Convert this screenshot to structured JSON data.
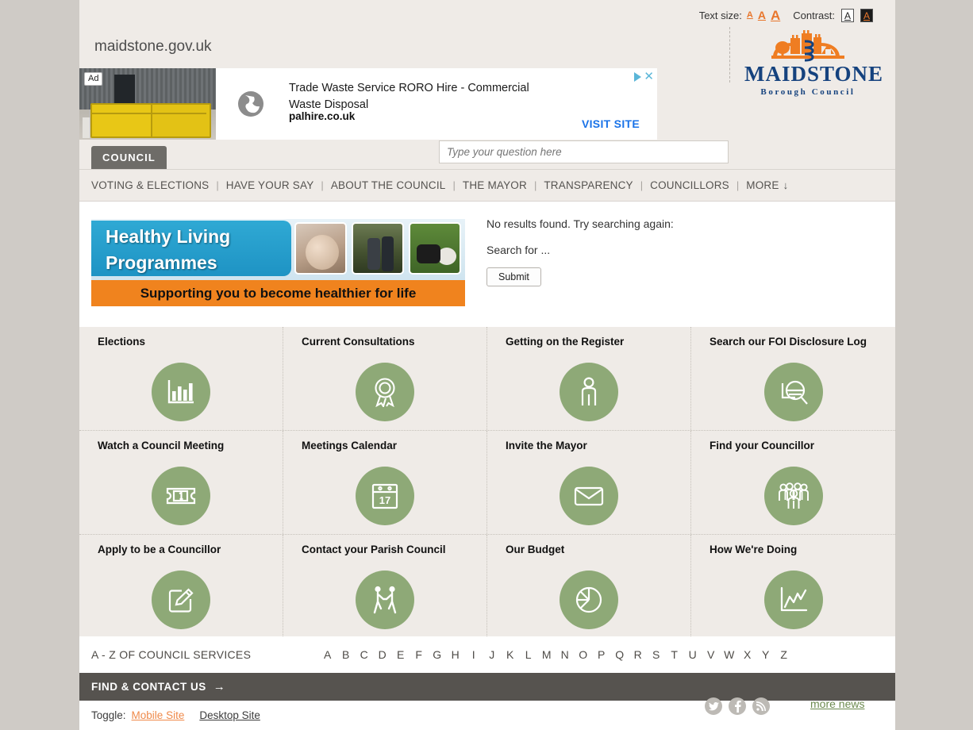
{
  "accessibility": {
    "text_size_label": "Text size:",
    "sizes": [
      "A",
      "A",
      "A"
    ],
    "contrast_label": "Contrast:",
    "contrast_options": [
      "A",
      "A"
    ],
    "accent_orange": "#e8762c"
  },
  "brand": {
    "site_url": "maidstone.gov.uk",
    "name": "MAIDSTONE",
    "sub": "Borough Council",
    "logo_blue": "#15427e",
    "logo_orange": "#ef7d22"
  },
  "ad": {
    "badge": "Ad",
    "title": "Trade Waste Service RORO Hire - Commercial Waste Disposal",
    "domain": "palhire.co.uk",
    "cta": "VISIT SITE"
  },
  "header": {
    "section_tab": "COUNCIL",
    "search_placeholder": "Type your question here",
    "search_value": ""
  },
  "nav": {
    "items": [
      "VOTING & ELECTIONS",
      "HAVE YOUR SAY",
      "ABOUT THE COUNCIL",
      "THE MAYOR",
      "TRANSPARENCY",
      "COUNCILLORS",
      "MORE"
    ],
    "more_arrow": "↓"
  },
  "promo": {
    "line1": "Healthy Living",
    "line2": "Programmes",
    "strapline": "Supporting you to become healthier for life",
    "blue": "#2fa9d4",
    "orange": "#f0831e"
  },
  "search_results": {
    "no_results": "No results found. Try searching again:",
    "search_label": "Search for ...",
    "submit_label": "Submit"
  },
  "tiles": {
    "circle_color": "#8ea977",
    "rows": [
      [
        {
          "title": "Elections",
          "icon": "bar-chart-icon"
        },
        {
          "title": "Current Consultations",
          "icon": "award-ribbon-icon"
        },
        {
          "title": "Getting on the Register",
          "icon": "person-icon"
        },
        {
          "title": "Search our FOI Disclosure Log",
          "icon": "magnifier-document-icon"
        }
      ],
      [
        {
          "title": "Watch a Council Meeting",
          "icon": "ticket-icon"
        },
        {
          "title": "Meetings Calendar",
          "icon": "calendar-icon"
        },
        {
          "title": "Invite the Mayor",
          "icon": "envelope-icon"
        },
        {
          "title": "Find your Councillor",
          "icon": "people-group-icon"
        }
      ],
      [
        {
          "title": "Apply to be a Councillor",
          "icon": "edit-pencil-icon"
        },
        {
          "title": "Contact your Parish Council",
          "icon": "handshake-icon"
        },
        {
          "title": "Our Budget",
          "icon": "pie-chart-icon"
        },
        {
          "title": "How We're Doing",
          "icon": "line-chart-icon"
        }
      ]
    ],
    "calendar_day": "17"
  },
  "social": {
    "items": [
      "twitter-icon",
      "facebook-icon",
      "rss-icon"
    ],
    "more_news": "more news",
    "more_news_color": "#6c8a4f"
  },
  "az": {
    "label": "A - Z OF COUNCIL SERVICES",
    "letters": [
      "A",
      "B",
      "C",
      "D",
      "E",
      "F",
      "G",
      "H",
      "I",
      "J",
      "K",
      "L",
      "M",
      "N",
      "O",
      "P",
      "Q",
      "R",
      "S",
      "T",
      "U",
      "V",
      "W",
      "X",
      "Y",
      "Z"
    ]
  },
  "footer": {
    "find_contact": "FIND & CONTACT US",
    "find_arrow": "→",
    "toggle_label": "Toggle:",
    "mobile_site": "Mobile Site",
    "desktop_site": "Desktop Site"
  }
}
